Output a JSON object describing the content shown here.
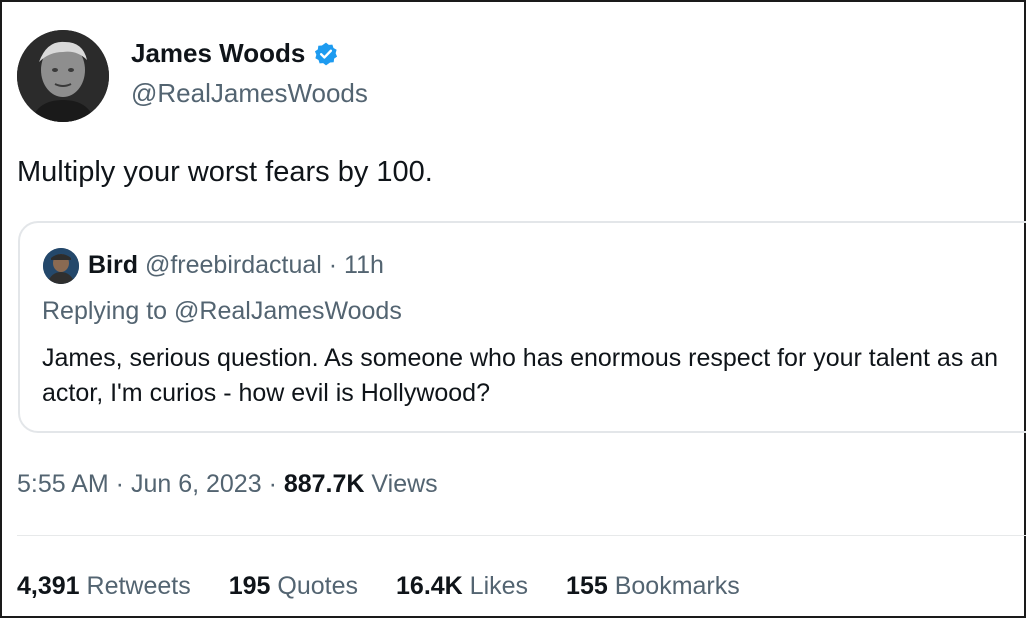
{
  "author": {
    "display_name": "James Woods",
    "handle": "@RealJamesWoods",
    "verified": true,
    "verified_color": "#1d9bf0"
  },
  "tweet": {
    "text": "Multiply your worst fears by 100."
  },
  "quoted_tweet": {
    "name": "Bird",
    "handle": "@freebirdactual",
    "time_sep": " · ",
    "time": "11h",
    "replying_prefix": "Replying to ",
    "replying_to": "@RealJamesWoods",
    "text": "James, serious question. As someone who has enormous respect for your talent as an actor, I'm curios - how evil is Hollywood?"
  },
  "meta": {
    "time": "5:55 AM",
    "sep1": " · ",
    "date": "Jun 6, 2023",
    "sep2": " · ",
    "views_count": "887.7K",
    "views_label": " Views"
  },
  "stats": {
    "retweets_count": "4,391",
    "retweets_label": " Retweets",
    "quotes_count": "195",
    "quotes_label": " Quotes",
    "likes_count": "16.4K",
    "likes_label": " Likes",
    "bookmarks_count": "155",
    "bookmarks_label": " Bookmarks"
  },
  "colors": {
    "text_primary": "#0f1419",
    "text_secondary": "#536471",
    "border": "#e3e6e9"
  }
}
